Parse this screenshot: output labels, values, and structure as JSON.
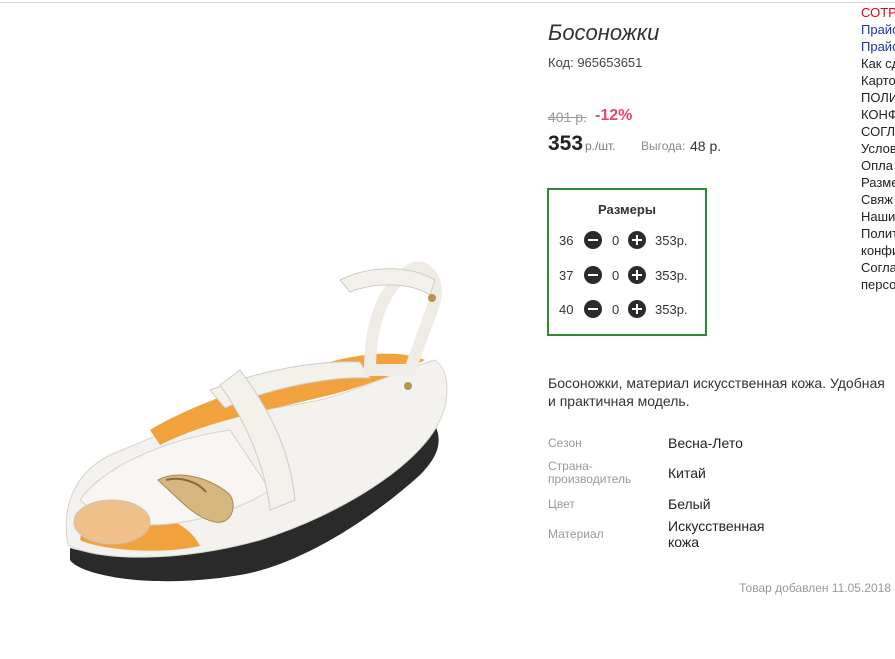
{
  "product": {
    "title": "Босоножки",
    "code": "Код: 965653651",
    "old_price": "401 р.",
    "discount": "-12%",
    "price": "353",
    "unit": "р./шт.",
    "saving_label": "Выгода:",
    "saving_value": "48 р.",
    "description": "Босоножки, материал искусственная кожа. Удобная и практичная модель.",
    "added": "Товар добавлен 11.05.2018"
  },
  "sizes": {
    "title": "Размеры",
    "rows": [
      {
        "size": "36",
        "qty": "0",
        "price": "353р."
      },
      {
        "size": "37",
        "qty": "0",
        "price": "353р."
      },
      {
        "size": "40",
        "qty": "0",
        "price": "353р."
      }
    ]
  },
  "properties": [
    {
      "label": "Сезон",
      "value": "Весна-Лето"
    },
    {
      "label": "Страна-производитель",
      "value": "Китай"
    },
    {
      "label": "Цвет",
      "value": "Белый"
    },
    {
      "label": "Материал",
      "value": "Искусственная кожа"
    }
  ],
  "side_menu": [
    "СОТР",
    "Прайс",
    "Прайс",
    "Как сд",
    "Карто",
    "ПОЛИ",
    "КОНФ",
    "СОГЛ",
    "Услов",
    "Опла",
    "Разме",
    "Свяж",
    "Наши",
    "Полит",
    "конфи",
    "Согла",
    "персо"
  ],
  "colors": {
    "accent_green": "#2e8b32",
    "discount_pink": "#e8456b",
    "menu_red": "#e0001a",
    "menu_blue": "#1a33b0"
  }
}
